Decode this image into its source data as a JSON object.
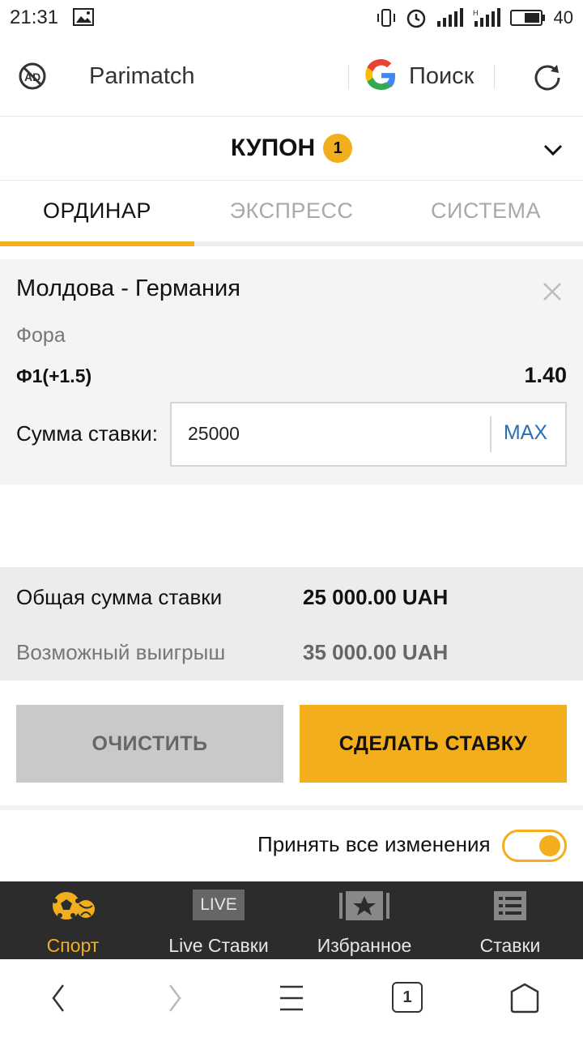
{
  "status_bar": {
    "time": "21:31",
    "battery_level": "40",
    "icons": [
      "gallery-icon",
      "vibrate-icon",
      "alarm-icon",
      "signal-icon",
      "signal-h-icon",
      "battery-icon"
    ]
  },
  "browser": {
    "site_name": "Parimatch",
    "search_label": "Поиск",
    "icons": [
      "adblock-icon",
      "google-icon",
      "reload-icon"
    ]
  },
  "coupon": {
    "title": "КУПОН",
    "count": "1"
  },
  "tabs": [
    {
      "label": "ОРДИНАР",
      "active": true
    },
    {
      "label": "ЭКСПРЕСС",
      "active": false
    },
    {
      "label": "СИСТЕМА",
      "active": false
    }
  ],
  "bet": {
    "match": "Молдова - Германия",
    "market": "Фора",
    "outcome": "Ф1(+1.5)",
    "odds": "1.40",
    "stake_label": "Сумма ставки:",
    "stake_value": "25000",
    "max_label": "MAX"
  },
  "totals": {
    "total_label": "Общая сумма ставки",
    "total_value": "25 000.00 UAH",
    "win_label": "Возможный выигрыш",
    "win_value": "35 000.00 UAH"
  },
  "buttons": {
    "clear": "ОЧИСТИТЬ",
    "place_bet": "СДЕЛАТЬ СТАВКУ"
  },
  "accept_changes": {
    "label": "Принять все изменения",
    "enabled": true
  },
  "bottom_nav": [
    {
      "label": "Спорт",
      "icon": "sport-ball-icon",
      "active": true
    },
    {
      "label": "Live Ставки",
      "icon": "live-icon",
      "badge": "LIVE",
      "active": false
    },
    {
      "label": "Избранное",
      "icon": "star-icon",
      "active": false
    },
    {
      "label": "Ставки",
      "icon": "list-icon",
      "active": false
    }
  ],
  "system_nav": {
    "tab_count": "1",
    "icons": [
      "back-icon",
      "forward-icon",
      "menu-icon",
      "tabs-icon",
      "home-icon"
    ]
  },
  "colors": {
    "accent": "#f2ae1c",
    "link": "#2a6fb0",
    "nav_bg": "#2c2c2c"
  }
}
